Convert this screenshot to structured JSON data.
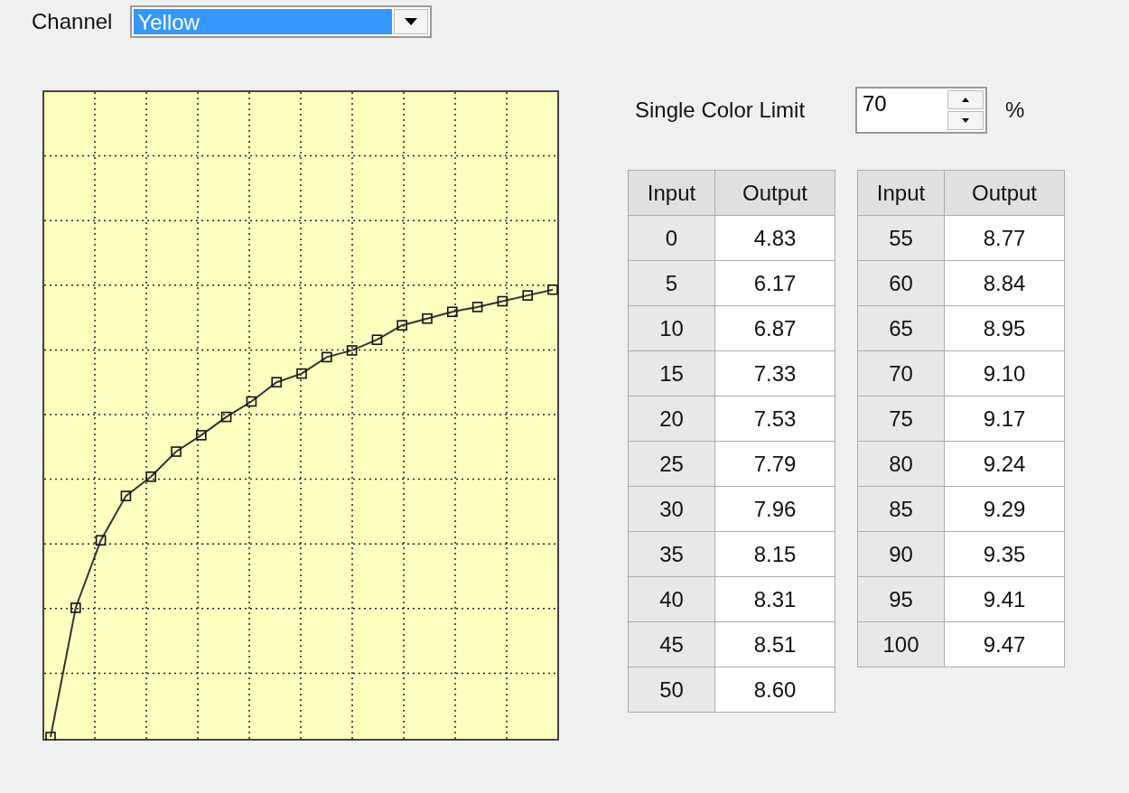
{
  "channel": {
    "label": "Channel",
    "value": "Yellow"
  },
  "single_color_limit": {
    "label": "Single Color Limit",
    "value": "70",
    "unit": "%"
  },
  "tables": [
    {
      "columns": [
        "Input",
        "Output"
      ],
      "rows": [
        [
          "0",
          "4.83"
        ],
        [
          "5",
          "6.17"
        ],
        [
          "10",
          "6.87"
        ],
        [
          "15",
          "7.33"
        ],
        [
          "20",
          "7.53"
        ],
        [
          "25",
          "7.79"
        ],
        [
          "30",
          "7.96"
        ],
        [
          "35",
          "8.15"
        ],
        [
          "40",
          "8.31"
        ],
        [
          "45",
          "8.51"
        ],
        [
          "50",
          "8.60"
        ]
      ]
    },
    {
      "columns": [
        "Input",
        "Output"
      ],
      "rows": [
        [
          "55",
          "8.77"
        ],
        [
          "60",
          "8.84"
        ],
        [
          "65",
          "8.95"
        ],
        [
          "70",
          "9.10"
        ],
        [
          "75",
          "9.17"
        ],
        [
          "80",
          "9.24"
        ],
        [
          "85",
          "9.29"
        ],
        [
          "90",
          "9.35"
        ],
        [
          "95",
          "9.41"
        ],
        [
          "100",
          "9.47"
        ]
      ]
    }
  ]
}
